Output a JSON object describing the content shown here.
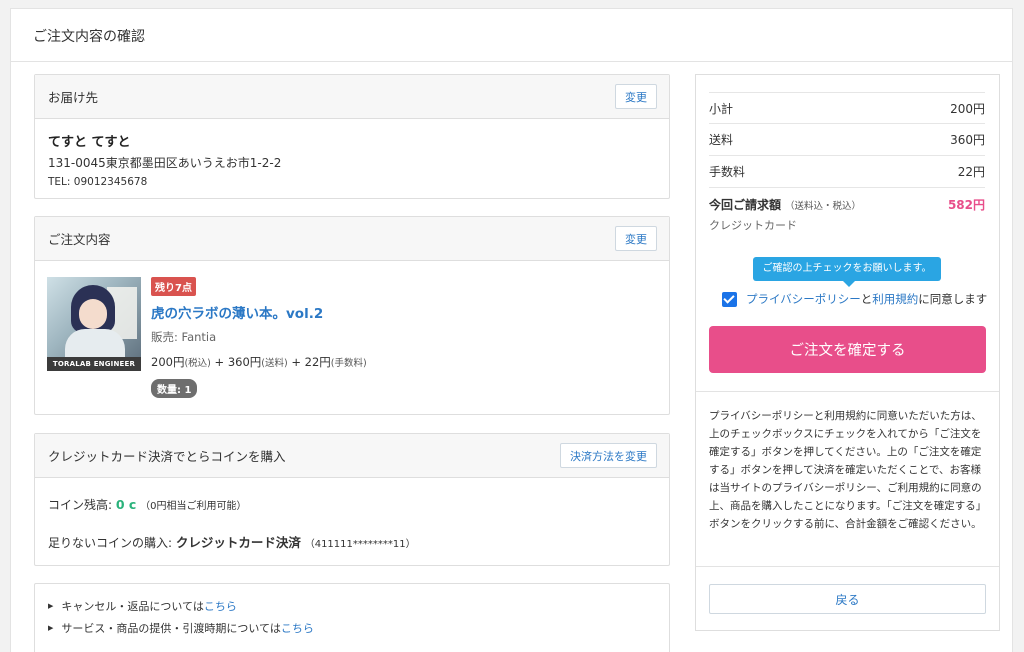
{
  "page": {
    "title": "ご注文内容の確認"
  },
  "delivery": {
    "heading": "お届け先",
    "change_label": "変更",
    "name": "てすと てすと",
    "address": "131-0045東京都墨田区あいうえお市1-2-2",
    "tel": "TEL: 09012345678"
  },
  "order": {
    "heading": "ご注文内容",
    "change_label": "変更",
    "cover_text": "TORALAB ENGINEER",
    "stock_badge": "残り7点",
    "title": "虎の穴ラボの薄い本。vol.2",
    "seller": "販売: Fantia",
    "price_item": "200円",
    "price_item_note": "(税込)",
    "price_ship": " + 360円",
    "price_ship_note": "(送料)",
    "price_fee": " + 22円",
    "price_fee_note": "(手数料)",
    "qty": "数量: 1"
  },
  "payment": {
    "heading": "クレジットカード決済でとらコインを購入",
    "change_label": "決済方法を変更",
    "balance_label": "コイン残高: ",
    "balance_value": "0 c",
    "balance_note": "（0円相当ご利用可能）",
    "shortfall_label": "足りないコインの購入: ",
    "shortfall_method": "クレジットカード決済",
    "shortfall_card": "（411111********11）"
  },
  "notes": {
    "items": [
      {
        "text": "キャンセル・返品については",
        "link": "こちら"
      },
      {
        "text": "サービス・商品の提供・引渡時期については",
        "link": "こちら"
      }
    ]
  },
  "summary": {
    "rows": [
      {
        "label": "小計",
        "value": "200円"
      },
      {
        "label": "送料",
        "value": "360円"
      },
      {
        "label": "手数料",
        "value": "22円"
      }
    ],
    "total_label": "今回ご請求額",
    "total_note": "（送料込・税込）",
    "total_value": "582円",
    "payment_method": "クレジットカード",
    "tooltip": "ご確認の上チェックをお願いします。",
    "agree_privacy": "プライバシーポリシー",
    "agree_and": "と",
    "agree_terms": "利用規約",
    "agree_suffix": "に同意します",
    "confirm_label": "ご注文を確定する",
    "legal_text": "プライバシーポリシーと利用規約に同意いただいた方は、上のチェックボックスにチェックを入れてから「ご注文を確定する」ボタンを押してください。上の「ご注文を確定する」ボタンを押して決済を確定いただくことで、お客様は当サイトのプライバシーポリシー、ご利用規約に同意の上、商品を購入したことになります。「ご注文を確定する」ボタンをクリックする前に、合計金額をご確認ください。",
    "back_label": "戻る"
  },
  "colors": {
    "accent": "#e84e8a",
    "link": "#2b78c5",
    "tooltip": "#2aa5e3",
    "stock": "#d9534f"
  }
}
